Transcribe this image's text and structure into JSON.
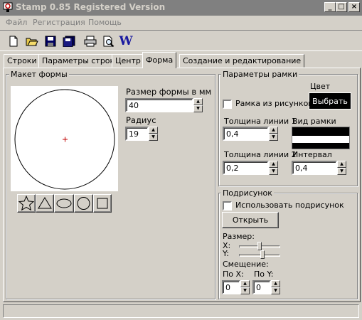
{
  "window": {
    "title": "Stamp 0.85 Registered Version"
  },
  "menu": {
    "items": [
      "Файл",
      "Регистрация",
      "Помощь"
    ]
  },
  "toolbar": {
    "word_label": "W"
  },
  "tabs": [
    "Строки",
    "Параметры строк",
    "Центр",
    "Форма",
    "Создание и редактирование"
  ],
  "active_tab": "Форма",
  "form_layout": {
    "title": "Макет формы",
    "size_label": "Размер формы в мм",
    "size_value": "40",
    "radius_label": "Радиус",
    "radius_value": "19"
  },
  "frame_params": {
    "title": "Параметры рамки",
    "color_label": "Цвет",
    "pick_button": "Выбрать",
    "from_pictures_label": "Рамка из рисунков",
    "line1_label": "Толщина линии 1",
    "line1_value": "0,4",
    "frame_view_label": "Вид рамки",
    "line2_label": "Толщина линии 2",
    "line2_value": "0,2",
    "interval_label": "Интервал",
    "interval_value": "0,4"
  },
  "subpicture": {
    "title": "Подрисунок",
    "use_label": "Использовать подрисунок",
    "open_button": "Открыть",
    "size_label": "Размер:",
    "x_label": "X:",
    "y_label": "Y:",
    "offset_label": "Смещение:",
    "offset_x_label": "По X:",
    "offset_y_label": "По Y:",
    "offset_x_value": "0",
    "offset_y_value": "0"
  },
  "colors": {
    "titlebar": "#808080",
    "face": "#d4d0c8",
    "pick_button_bg": "#000000",
    "accent_red": "#c00000",
    "word_blue": "#1a1aa0"
  }
}
